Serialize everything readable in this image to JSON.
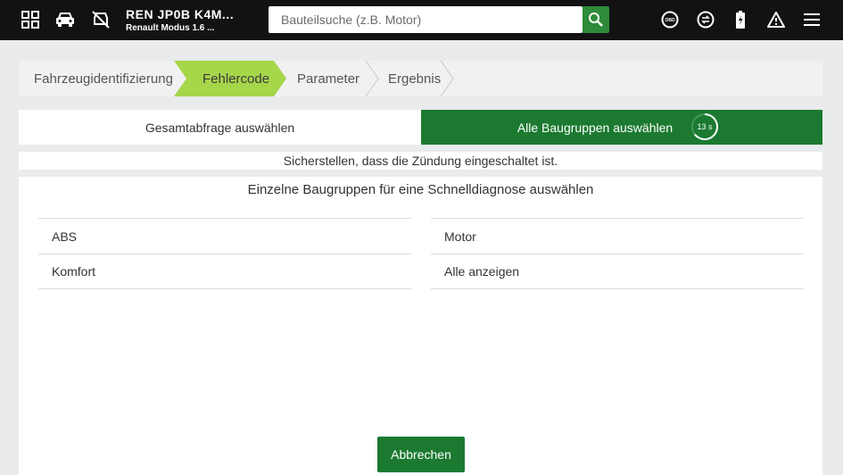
{
  "header": {
    "icons": [
      "grid-icon",
      "car-icon",
      "car-crossed-icon",
      "obd-icon",
      "transfer-icon",
      "battery-icon",
      "warning-icon",
      "menu-icon"
    ],
    "vehicle_code": "REN JP0B K4M...",
    "vehicle_model": "Renault Modus 1.6 ...",
    "search_placeholder": "Bauteilsuche (z.B. Motor)",
    "obd_label": "OBD"
  },
  "steps": [
    {
      "label": "Fahrzeugidentifizierung",
      "active": false
    },
    {
      "label": "Fehlercode",
      "active": true
    },
    {
      "label": "Parameter",
      "active": false
    },
    {
      "label": "Ergebnis",
      "active": false
    }
  ],
  "choices": {
    "left_label": "Gesamtabfrage auswählen",
    "right_label": "Alle Baugruppen auswählen",
    "timer": "13 s"
  },
  "notice": "Sicherstellen, dass die Zündung eingeschaltet ist.",
  "panel": {
    "title": "Einzelne Baugruppen für eine Schnelldiagnose auswählen",
    "groups_left": [
      "ABS",
      "Komfort"
    ],
    "groups_right": [
      "Motor",
      "Alle anzeigen"
    ],
    "cancel_label": "Abbrechen"
  },
  "colors": {
    "topbar": "#121212",
    "accent_green": "#1b7a30",
    "active_step": "#a6d64a",
    "search_button": "#2e8b3a"
  }
}
